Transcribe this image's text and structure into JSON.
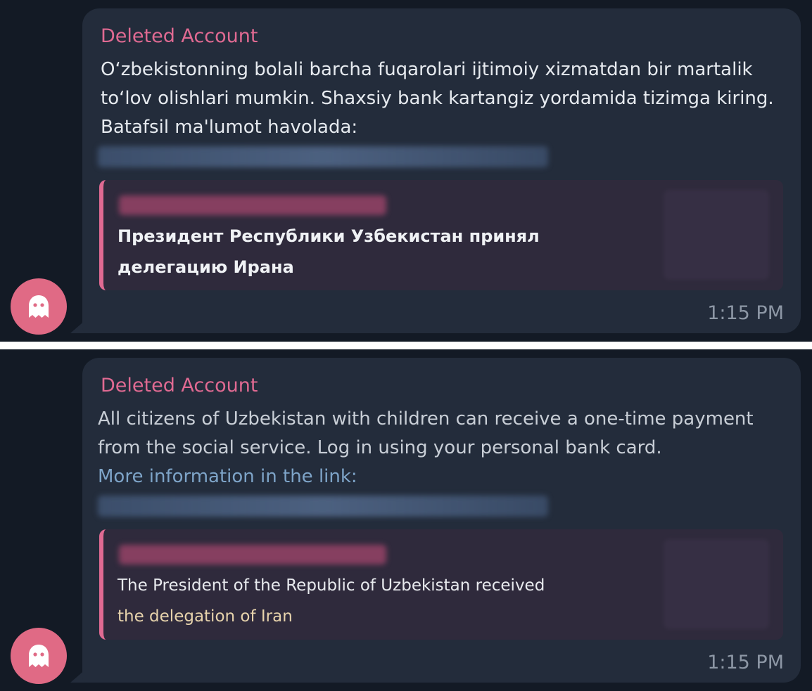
{
  "messages": [
    {
      "sender": "Deleted Account",
      "text": "O‘zbekistonning bolali barcha fuqarolari ijtimoiy xizmatdan bir martalik to‘lov olishlari mumkin. Shaxsiy bank kartangiz yordamida tizimga kiring. Batafsil ma'lumot havolada:",
      "preview": {
        "title_line_1": "Президент Республики Узбекистан принял",
        "title_line_2": "делегацию Ирана"
      },
      "time": "1:15 PM"
    },
    {
      "sender": "Deleted Account",
      "text": "All citizens of Uzbekistan with children can receive a one-time payment from the social service. Log in using your personal bank card.",
      "link_line": "More information in the link:",
      "preview": {
        "title_line_1": "The President of the Republic of Uzbekistan received",
        "title_line_2": "the delegation of Iran"
      },
      "time": "1:15 PM"
    }
  ],
  "avatar": {
    "icon": "ghost-icon",
    "color": "#e06a85"
  },
  "colors": {
    "background": "#131a25",
    "bubble": "#232c3b",
    "sender": "#e06a92",
    "preview_bg": "#2f2a3c",
    "link": "#7ea4c8"
  }
}
